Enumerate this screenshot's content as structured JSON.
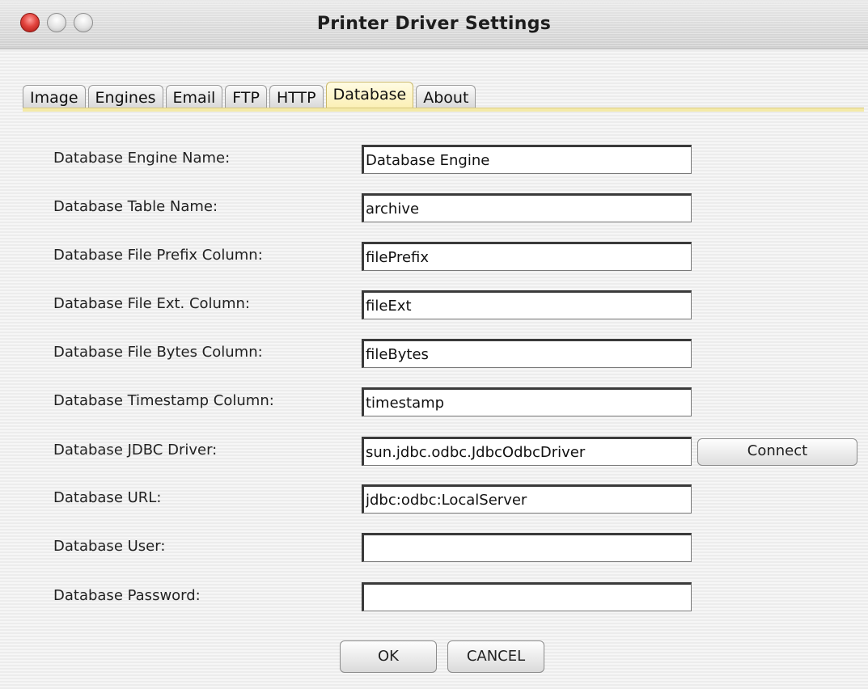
{
  "window": {
    "title": "Printer Driver Settings"
  },
  "tabs": [
    {
      "label": "Image"
    },
    {
      "label": "Engines"
    },
    {
      "label": "Email"
    },
    {
      "label": "FTP"
    },
    {
      "label": "HTTP"
    },
    {
      "label": "Database",
      "active": true
    },
    {
      "label": "About"
    }
  ],
  "form": {
    "engine_name": {
      "label": "Database Engine Name:",
      "value": "Database Engine"
    },
    "table_name": {
      "label": "Database Table Name:",
      "value": "archive"
    },
    "file_prefix_column": {
      "label": "Database File Prefix Column:",
      "value": "filePrefix"
    },
    "file_ext_column": {
      "label": "Database File Ext. Column:",
      "value": "fileExt"
    },
    "file_bytes_column": {
      "label": "Database File Bytes Column:",
      "value": "fileBytes"
    },
    "timestamp_column": {
      "label": "Database Timestamp Column:",
      "value": "timestamp"
    },
    "jdbc_driver": {
      "label": "Database JDBC Driver:",
      "value": "sun.jdbc.odbc.JdbcOdbcDriver"
    },
    "url": {
      "label": "Database URL:",
      "value": "jdbc:odbc:LocalServer"
    },
    "user": {
      "label": "Database User:",
      "value": ""
    },
    "password": {
      "label": "Database Password:",
      "value": ""
    }
  },
  "buttons": {
    "connect": "Connect",
    "ok": "OK",
    "cancel": "CANCEL"
  },
  "colors": {
    "active_tab": "#fbf0b6",
    "close_button": "#e2453f"
  }
}
